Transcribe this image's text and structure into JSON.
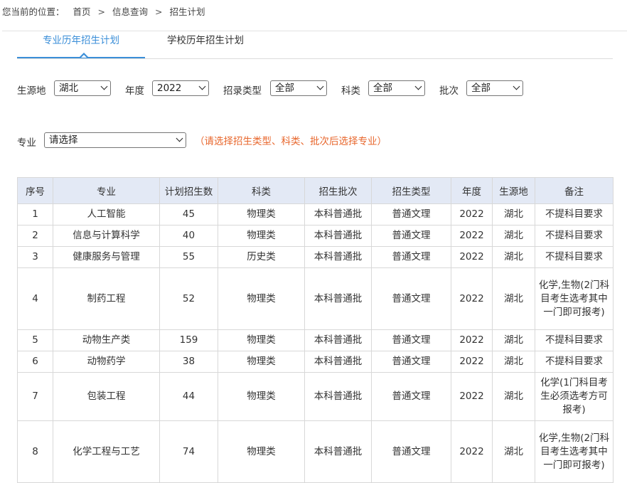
{
  "breadcrumb": {
    "prefix": "您当前的位置：",
    "items": [
      "首页",
      "信息查询",
      "招生计划"
    ],
    "separator": ">"
  },
  "tabs": [
    {
      "label": "专业历年招生计划",
      "active": true
    },
    {
      "label": "学校历年招生计划",
      "active": false
    }
  ],
  "filters": {
    "origin": {
      "label": "生源地",
      "value": "湖北"
    },
    "year": {
      "label": "年度",
      "value": "2022"
    },
    "admission_type": {
      "label": "招录类型",
      "value": "全部"
    },
    "subject": {
      "label": "科类",
      "value": "全部"
    },
    "batch": {
      "label": "批次",
      "value": "全部"
    }
  },
  "major": {
    "label": "专业",
    "value": "请选择",
    "hint": "（请选择招生类型、科类、批次后选择专业）"
  },
  "table": {
    "headers": [
      "序号",
      "专业",
      "计划招生数",
      "科类",
      "招生批次",
      "招生类型",
      "年度",
      "生源地",
      "备注"
    ],
    "rows": [
      [
        "1",
        "人工智能",
        "45",
        "物理类",
        "本科普通批",
        "普通文理",
        "2022",
        "湖北",
        "不提科目要求"
      ],
      [
        "2",
        "信息与计算科学",
        "40",
        "物理类",
        "本科普通批",
        "普通文理",
        "2022",
        "湖北",
        "不提科目要求"
      ],
      [
        "3",
        "健康服务与管理",
        "55",
        "历史类",
        "本科普通批",
        "普通文理",
        "2022",
        "湖北",
        "不提科目要求"
      ],
      [
        "4",
        "制药工程",
        "52",
        "物理类",
        "本科普通批",
        "普通文理",
        "2022",
        "湖北",
        "化学,生物(2门科目考生选考其中一门即可报考)"
      ],
      [
        "5",
        "动物生产类",
        "159",
        "物理类",
        "本科普通批",
        "普通文理",
        "2022",
        "湖北",
        "不提科目要求"
      ],
      [
        "6",
        "动物药学",
        "38",
        "物理类",
        "本科普通批",
        "普通文理",
        "2022",
        "湖北",
        "不提科目要求"
      ],
      [
        "7",
        "包装工程",
        "44",
        "物理类",
        "本科普通批",
        "普通文理",
        "2022",
        "湖北",
        "化学(1门科目考生必须选考方可报考)"
      ],
      [
        "8",
        "化学工程与工艺",
        "74",
        "物理类",
        "本科普通批",
        "普通文理",
        "2022",
        "湖北",
        "化学,生物(2门科目考生选考其中一门即可报考)"
      ]
    ]
  },
  "colors": {
    "accent": "#3a8ed8",
    "hint": "#e8672d",
    "header_bg": "#e3e9f5"
  }
}
